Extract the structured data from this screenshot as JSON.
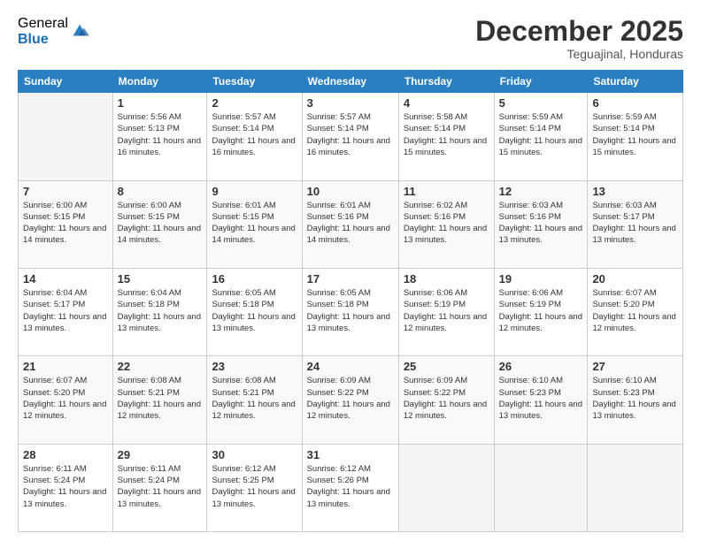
{
  "logo": {
    "general": "General",
    "blue": "Blue"
  },
  "title": "December 2025",
  "location": "Teguajinal, Honduras",
  "days_of_week": [
    "Sunday",
    "Monday",
    "Tuesday",
    "Wednesday",
    "Thursday",
    "Friday",
    "Saturday"
  ],
  "weeks": [
    [
      {
        "day": "",
        "sunrise": "",
        "sunset": "",
        "daylight": ""
      },
      {
        "day": "1",
        "sunrise": "Sunrise: 5:56 AM",
        "sunset": "Sunset: 5:13 PM",
        "daylight": "Daylight: 11 hours and 16 minutes."
      },
      {
        "day": "2",
        "sunrise": "Sunrise: 5:57 AM",
        "sunset": "Sunset: 5:14 PM",
        "daylight": "Daylight: 11 hours and 16 minutes."
      },
      {
        "day": "3",
        "sunrise": "Sunrise: 5:57 AM",
        "sunset": "Sunset: 5:14 PM",
        "daylight": "Daylight: 11 hours and 16 minutes."
      },
      {
        "day": "4",
        "sunrise": "Sunrise: 5:58 AM",
        "sunset": "Sunset: 5:14 PM",
        "daylight": "Daylight: 11 hours and 15 minutes."
      },
      {
        "day": "5",
        "sunrise": "Sunrise: 5:59 AM",
        "sunset": "Sunset: 5:14 PM",
        "daylight": "Daylight: 11 hours and 15 minutes."
      },
      {
        "day": "6",
        "sunrise": "Sunrise: 5:59 AM",
        "sunset": "Sunset: 5:14 PM",
        "daylight": "Daylight: 11 hours and 15 minutes."
      }
    ],
    [
      {
        "day": "7",
        "sunrise": "Sunrise: 6:00 AM",
        "sunset": "Sunset: 5:15 PM",
        "daylight": "Daylight: 11 hours and 14 minutes."
      },
      {
        "day": "8",
        "sunrise": "Sunrise: 6:00 AM",
        "sunset": "Sunset: 5:15 PM",
        "daylight": "Daylight: 11 hours and 14 minutes."
      },
      {
        "day": "9",
        "sunrise": "Sunrise: 6:01 AM",
        "sunset": "Sunset: 5:15 PM",
        "daylight": "Daylight: 11 hours and 14 minutes."
      },
      {
        "day": "10",
        "sunrise": "Sunrise: 6:01 AM",
        "sunset": "Sunset: 5:16 PM",
        "daylight": "Daylight: 11 hours and 14 minutes."
      },
      {
        "day": "11",
        "sunrise": "Sunrise: 6:02 AM",
        "sunset": "Sunset: 5:16 PM",
        "daylight": "Daylight: 11 hours and 13 minutes."
      },
      {
        "day": "12",
        "sunrise": "Sunrise: 6:03 AM",
        "sunset": "Sunset: 5:16 PM",
        "daylight": "Daylight: 11 hours and 13 minutes."
      },
      {
        "day": "13",
        "sunrise": "Sunrise: 6:03 AM",
        "sunset": "Sunset: 5:17 PM",
        "daylight": "Daylight: 11 hours and 13 minutes."
      }
    ],
    [
      {
        "day": "14",
        "sunrise": "Sunrise: 6:04 AM",
        "sunset": "Sunset: 5:17 PM",
        "daylight": "Daylight: 11 hours and 13 minutes."
      },
      {
        "day": "15",
        "sunrise": "Sunrise: 6:04 AM",
        "sunset": "Sunset: 5:18 PM",
        "daylight": "Daylight: 11 hours and 13 minutes."
      },
      {
        "day": "16",
        "sunrise": "Sunrise: 6:05 AM",
        "sunset": "Sunset: 5:18 PM",
        "daylight": "Daylight: 11 hours and 13 minutes."
      },
      {
        "day": "17",
        "sunrise": "Sunrise: 6:05 AM",
        "sunset": "Sunset: 5:18 PM",
        "daylight": "Daylight: 11 hours and 13 minutes."
      },
      {
        "day": "18",
        "sunrise": "Sunrise: 6:06 AM",
        "sunset": "Sunset: 5:19 PM",
        "daylight": "Daylight: 11 hours and 12 minutes."
      },
      {
        "day": "19",
        "sunrise": "Sunrise: 6:06 AM",
        "sunset": "Sunset: 5:19 PM",
        "daylight": "Daylight: 11 hours and 12 minutes."
      },
      {
        "day": "20",
        "sunrise": "Sunrise: 6:07 AM",
        "sunset": "Sunset: 5:20 PM",
        "daylight": "Daylight: 11 hours and 12 minutes."
      }
    ],
    [
      {
        "day": "21",
        "sunrise": "Sunrise: 6:07 AM",
        "sunset": "Sunset: 5:20 PM",
        "daylight": "Daylight: 11 hours and 12 minutes."
      },
      {
        "day": "22",
        "sunrise": "Sunrise: 6:08 AM",
        "sunset": "Sunset: 5:21 PM",
        "daylight": "Daylight: 11 hours and 12 minutes."
      },
      {
        "day": "23",
        "sunrise": "Sunrise: 6:08 AM",
        "sunset": "Sunset: 5:21 PM",
        "daylight": "Daylight: 11 hours and 12 minutes."
      },
      {
        "day": "24",
        "sunrise": "Sunrise: 6:09 AM",
        "sunset": "Sunset: 5:22 PM",
        "daylight": "Daylight: 11 hours and 12 minutes."
      },
      {
        "day": "25",
        "sunrise": "Sunrise: 6:09 AM",
        "sunset": "Sunset: 5:22 PM",
        "daylight": "Daylight: 11 hours and 12 minutes."
      },
      {
        "day": "26",
        "sunrise": "Sunrise: 6:10 AM",
        "sunset": "Sunset: 5:23 PM",
        "daylight": "Daylight: 11 hours and 13 minutes."
      },
      {
        "day": "27",
        "sunrise": "Sunrise: 6:10 AM",
        "sunset": "Sunset: 5:23 PM",
        "daylight": "Daylight: 11 hours and 13 minutes."
      }
    ],
    [
      {
        "day": "28",
        "sunrise": "Sunrise: 6:11 AM",
        "sunset": "Sunset: 5:24 PM",
        "daylight": "Daylight: 11 hours and 13 minutes."
      },
      {
        "day": "29",
        "sunrise": "Sunrise: 6:11 AM",
        "sunset": "Sunset: 5:24 PM",
        "daylight": "Daylight: 11 hours and 13 minutes."
      },
      {
        "day": "30",
        "sunrise": "Sunrise: 6:12 AM",
        "sunset": "Sunset: 5:25 PM",
        "daylight": "Daylight: 11 hours and 13 minutes."
      },
      {
        "day": "31",
        "sunrise": "Sunrise: 6:12 AM",
        "sunset": "Sunset: 5:26 PM",
        "daylight": "Daylight: 11 hours and 13 minutes."
      },
      {
        "day": "",
        "sunrise": "",
        "sunset": "",
        "daylight": ""
      },
      {
        "day": "",
        "sunrise": "",
        "sunset": "",
        "daylight": ""
      },
      {
        "day": "",
        "sunrise": "",
        "sunset": "",
        "daylight": ""
      }
    ]
  ]
}
